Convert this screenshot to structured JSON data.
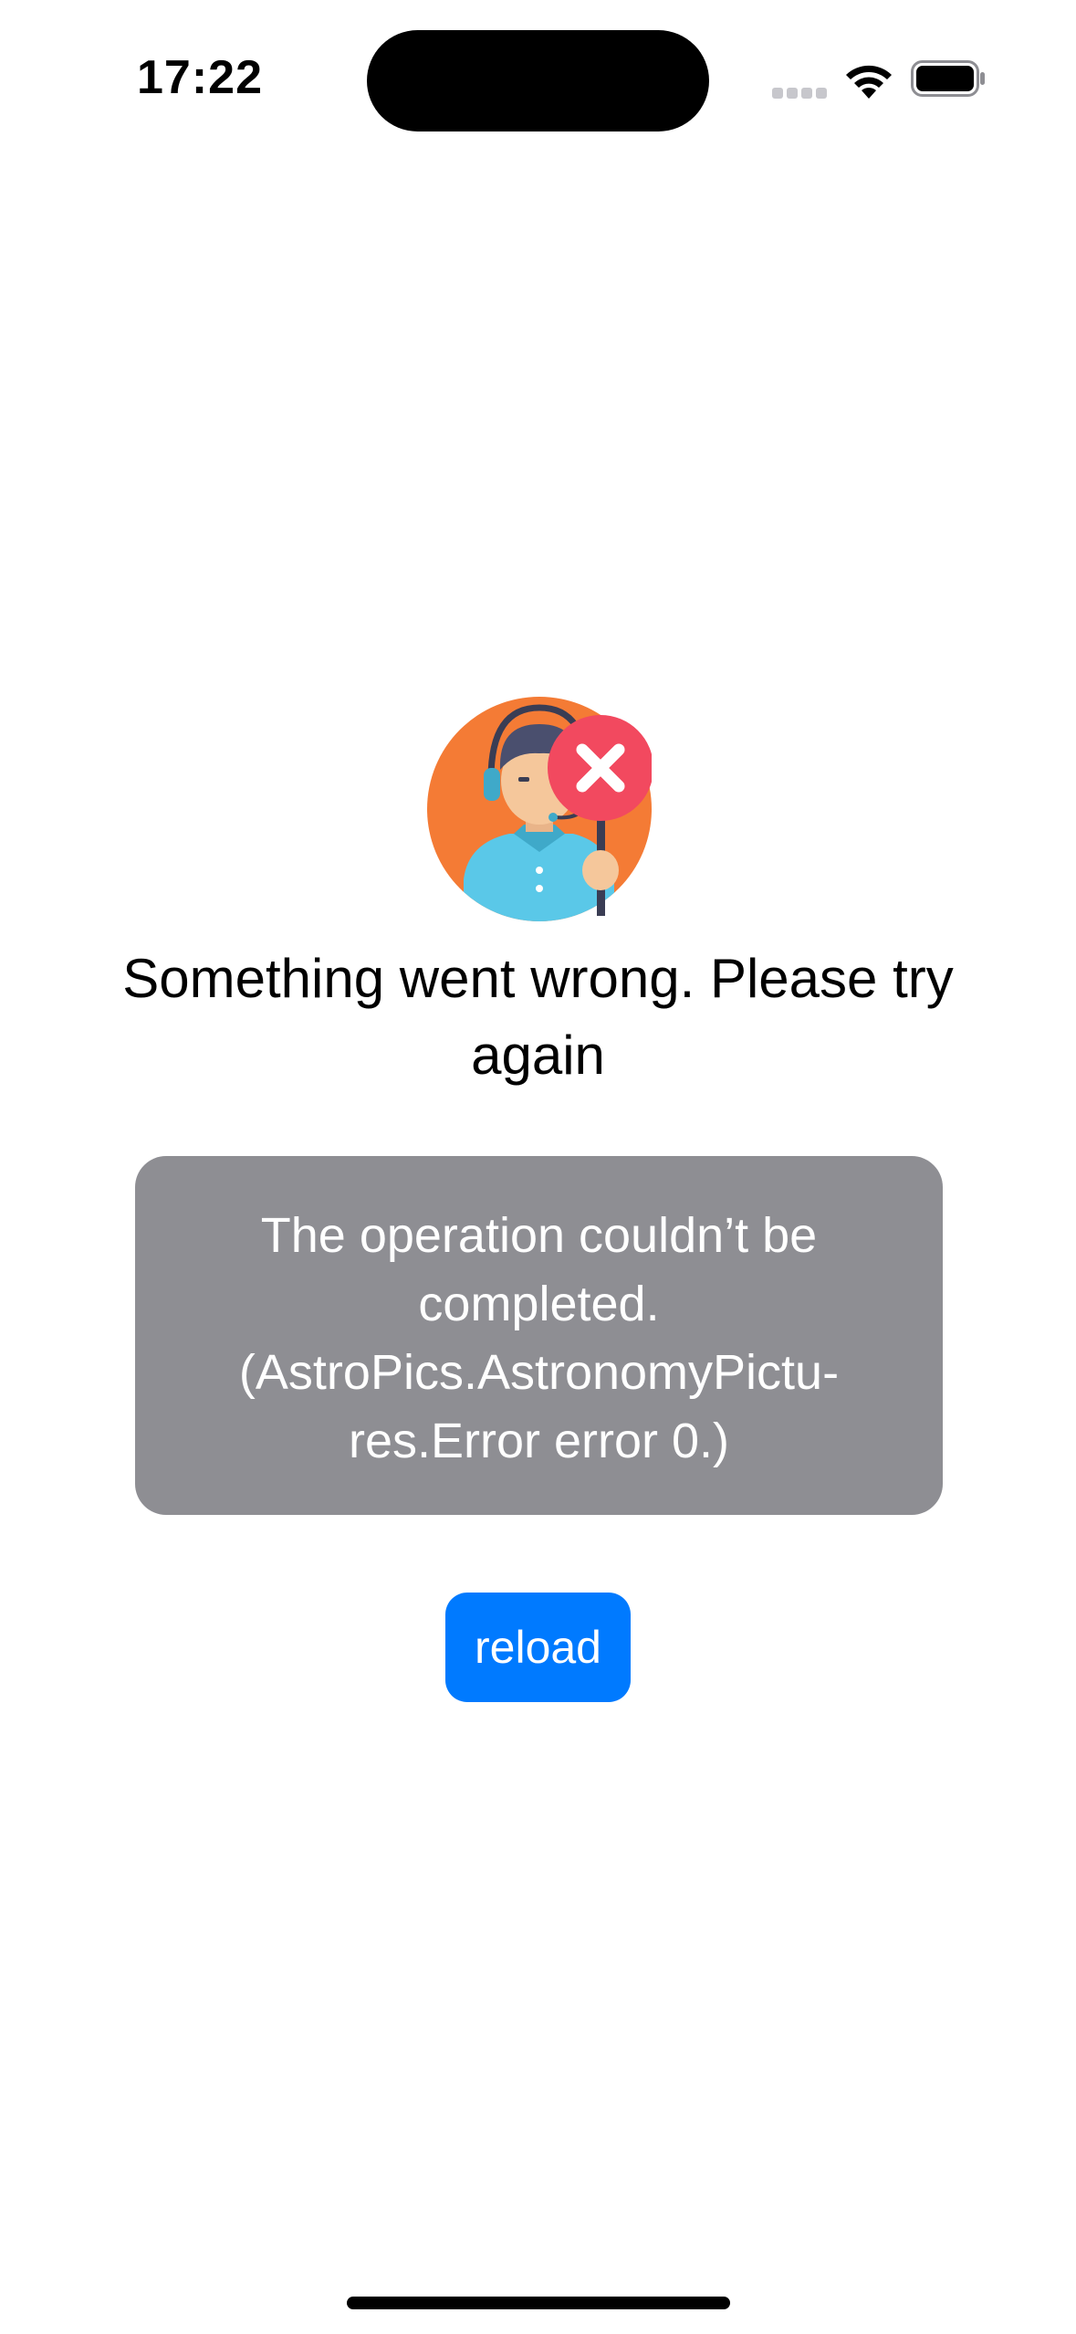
{
  "status_bar": {
    "time": "17:22",
    "signal_icon": "cellular-signal-icon",
    "wifi_icon": "wifi-icon",
    "battery_icon": "battery-icon"
  },
  "error_view": {
    "illustration_icon": "support-agent-error-icon",
    "title": "Something went wrong. Please try again",
    "message": "The operation couldn’t be completed. (AstroPics.AstronomyPictu-res.Error error 0.)",
    "reload_label": "reload"
  },
  "colors": {
    "accent": "#007aff",
    "message_box": "#8e8e93",
    "background": "#ffffff"
  }
}
